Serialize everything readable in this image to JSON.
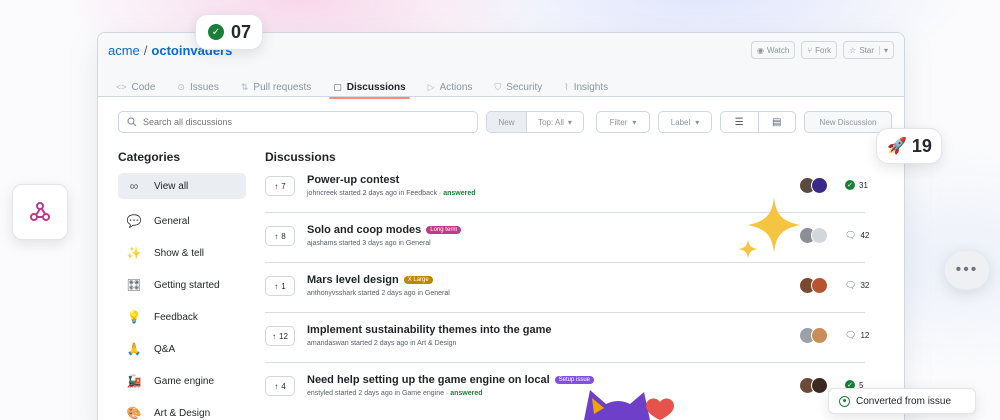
{
  "repo": {
    "owner": "acme",
    "separator": "/",
    "name": "octoinvaders"
  },
  "repo_actions": {
    "watch": "Watch",
    "fork": "Fork",
    "star": "Star"
  },
  "tabs": [
    {
      "label": "Code",
      "icon": "code-icon"
    },
    {
      "label": "Issues",
      "icon": "issue-icon"
    },
    {
      "label": "Pull requests",
      "icon": "pull-request-icon"
    },
    {
      "label": "Discussions",
      "icon": "discussions-icon",
      "active": true
    },
    {
      "label": "Actions",
      "icon": "actions-icon"
    },
    {
      "label": "Security",
      "icon": "shield-icon"
    },
    {
      "label": "Insights",
      "icon": "graph-icon"
    }
  ],
  "toolbar": {
    "search_placeholder": "Search all discussions",
    "new_label": "New",
    "top_label": "Top: All",
    "filter_label": "Filter",
    "label_label": "Label",
    "new_discussion": "New Discussion"
  },
  "categories": {
    "title": "Categories",
    "items": [
      {
        "emoji": "∞",
        "label": "View all"
      },
      {
        "emoji": "💬",
        "label": "General"
      },
      {
        "emoji": "✨",
        "label": "Show & tell"
      },
      {
        "emoji": "🎛",
        "label": "Getting started"
      },
      {
        "emoji": "💡",
        "label": "Feedback"
      },
      {
        "emoji": "🙏",
        "label": "Q&A"
      },
      {
        "emoji": "🚂",
        "label": "Game engine"
      },
      {
        "emoji": "🎨",
        "label": "Art & Design"
      }
    ]
  },
  "discussions": {
    "title": "Discussions",
    "rows": [
      {
        "votes": "7",
        "title": "Power-up contest",
        "label": "",
        "meta": "johncreek started 2 days ago in Feedback · ",
        "answered": "answered",
        "stat": "31",
        "stat_type": "answered"
      },
      {
        "votes": "8",
        "title": "Solo and coop modes",
        "label": "Long term",
        "label_color": "#bf3989",
        "meta": "ajashams started 3 days ago in General",
        "answered": "",
        "stat": "42",
        "stat_type": "comments"
      },
      {
        "votes": "1",
        "title": "Mars level design",
        "label": "X Large",
        "label_color": "#bf8700",
        "meta": "anthonyvsshark started 2 days ago in General",
        "answered": "",
        "stat": "32",
        "stat_type": "comments"
      },
      {
        "votes": "12",
        "title": "Implement sustainability themes into the game",
        "label": "",
        "meta": "amandaswan started 2 days ago in Art & Design",
        "answered": "",
        "stat": "12",
        "stat_type": "comments"
      },
      {
        "votes": "4",
        "title": "Need help setting up the game engine on local",
        "label": "Setup issue",
        "label_color": "#8250df",
        "meta": "enstyled started 2 days ago in Game engine · ",
        "answered": "answered",
        "stat": "5",
        "stat_type": "answered"
      }
    ]
  },
  "floating": {
    "count_a": "07",
    "count_b": "19",
    "chat": "•••",
    "converted": "Converted from issue"
  },
  "colors": {
    "accent": "#0969da",
    "success": "#1a7f37",
    "tab_underline": "#fd8c73"
  }
}
